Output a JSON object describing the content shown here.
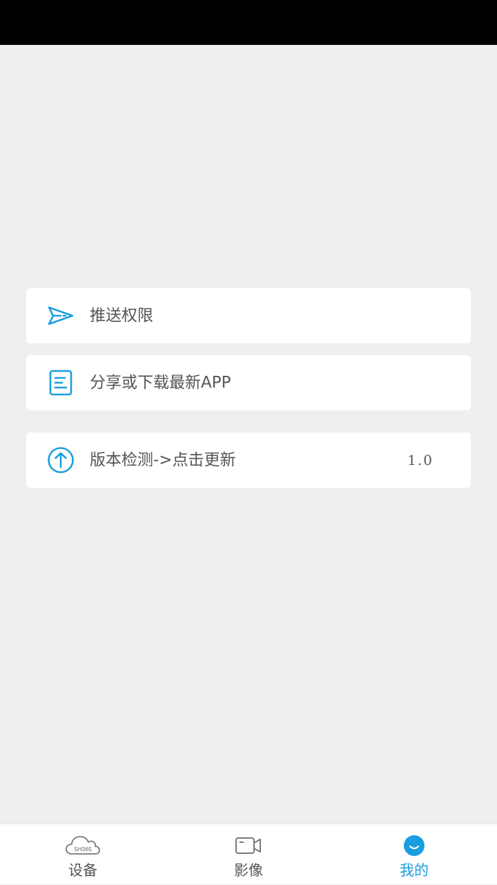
{
  "menu": {
    "items": [
      {
        "label": "推送权限",
        "icon": "send-icon"
      },
      {
        "label": "分享或下载最新APP",
        "icon": "document-icon"
      },
      {
        "label": "版本检测->点击更新",
        "icon": "upload-arrow-icon",
        "value": "1.0"
      }
    ]
  },
  "tabs": [
    {
      "label": "设备",
      "icon": "cloud-icon",
      "icon_text": "SH365",
      "active": false
    },
    {
      "label": "影像",
      "icon": "video-camera-icon",
      "active": false
    },
    {
      "label": "我的",
      "icon": "smile-icon",
      "active": true
    }
  ],
  "colors": {
    "accent": "#1a9ee0",
    "background": "#eef0ef",
    "card": "#ffffff",
    "text": "#555555",
    "status_bar": "#000000"
  }
}
